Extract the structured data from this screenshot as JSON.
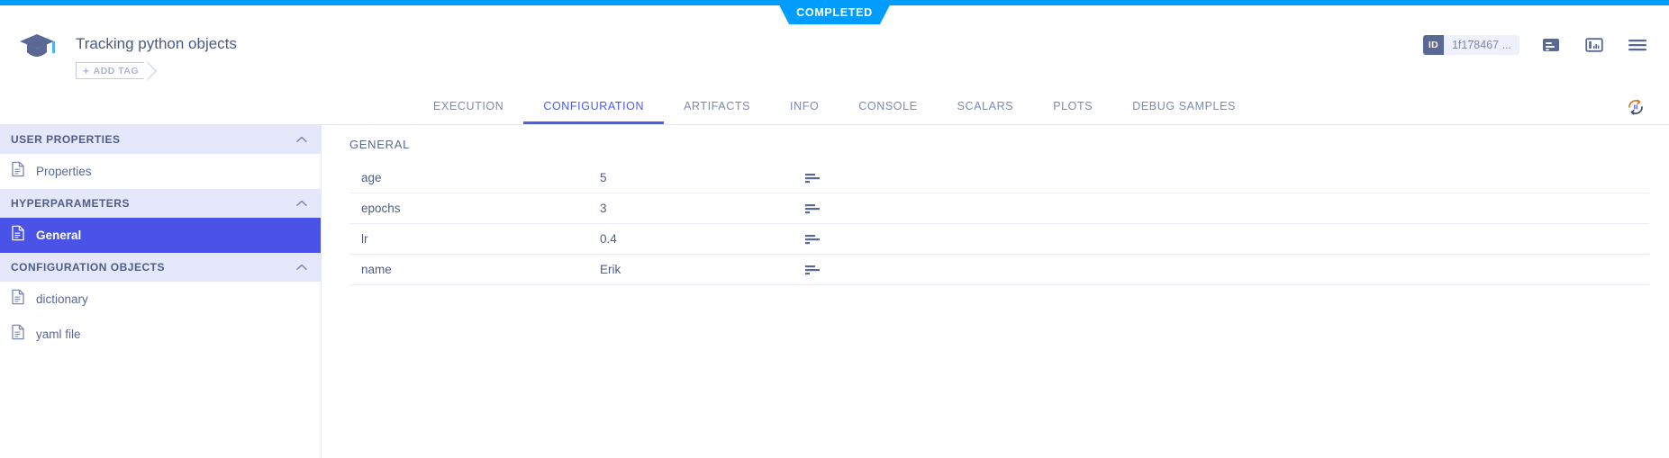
{
  "window": {
    "status_label": "COMPLETED",
    "accent_blue": "#009dff",
    "indigo": "#4b5cf0",
    "slate": "#5a6894"
  },
  "header": {
    "logo_icon": "graduation-cap-icon",
    "task_title": "Tracking python objects",
    "add_tag_plus": "+",
    "add_tag_label": "ADD TAG",
    "id_badge": {
      "tag": "ID",
      "value": "1f178467 ..."
    },
    "actions": [
      {
        "name": "task-details-icon",
        "title": "Details"
      },
      {
        "name": "task-preview-panel-icon",
        "title": "Preview panel"
      },
      {
        "name": "menu-icon",
        "title": "Menu"
      }
    ]
  },
  "tabs": [
    {
      "label": "EXECUTION",
      "active": false
    },
    {
      "label": "CONFIGURATION",
      "active": true
    },
    {
      "label": "ARTIFACTS",
      "active": false
    },
    {
      "label": "INFO",
      "active": false
    },
    {
      "label": "CONSOLE",
      "active": false
    },
    {
      "label": "SCALARS",
      "active": false
    },
    {
      "label": "PLOTS",
      "active": false
    },
    {
      "label": "DEBUG SAMPLES",
      "active": false
    }
  ],
  "refresh": {
    "icon": "auto-refresh-paused-icon"
  },
  "sidebar": {
    "sections": [
      {
        "title": "USER PROPERTIES",
        "items": [
          {
            "label": "Properties",
            "selected": false
          }
        ]
      },
      {
        "title": "HYPERPARAMETERS",
        "items": [
          {
            "label": "General",
            "selected": true
          }
        ]
      },
      {
        "title": "CONFIGURATION OBJECTS",
        "items": [
          {
            "label": "dictionary",
            "selected": false
          },
          {
            "label": "yaml file",
            "selected": false
          }
        ]
      }
    ]
  },
  "main": {
    "section_title": "GENERAL",
    "rows": [
      {
        "key": "age",
        "value": "5"
      },
      {
        "key": "epochs",
        "value": "3"
      },
      {
        "key": "lr",
        "value": "0.4"
      },
      {
        "key": "name",
        "value": "Erik"
      }
    ]
  }
}
